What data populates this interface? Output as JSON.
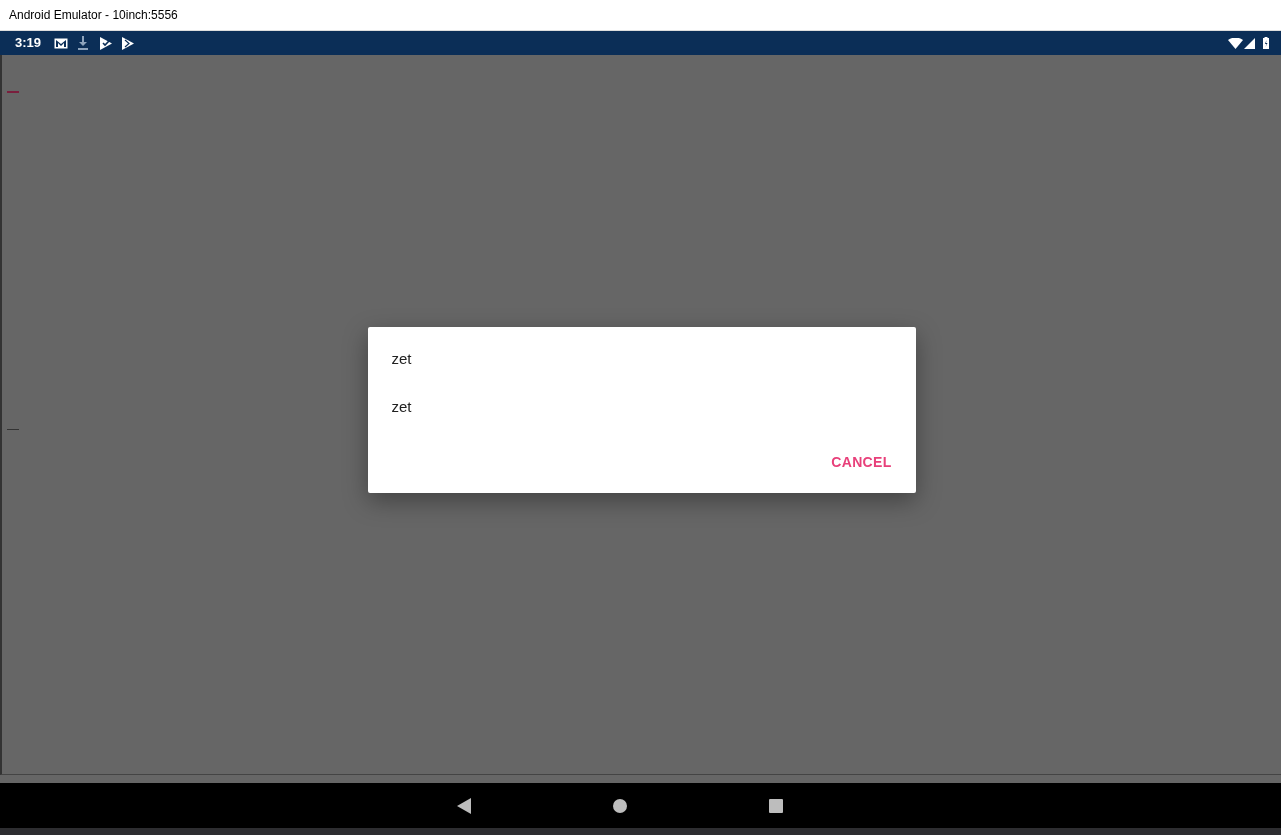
{
  "window": {
    "title": "Android Emulator - 10inch:5556"
  },
  "status_bar": {
    "time": "3:19"
  },
  "dialog": {
    "items": [
      {
        "label": "zet"
      },
      {
        "label": "zet"
      }
    ],
    "buttons": [
      {
        "label": "CANCEL"
      }
    ]
  }
}
